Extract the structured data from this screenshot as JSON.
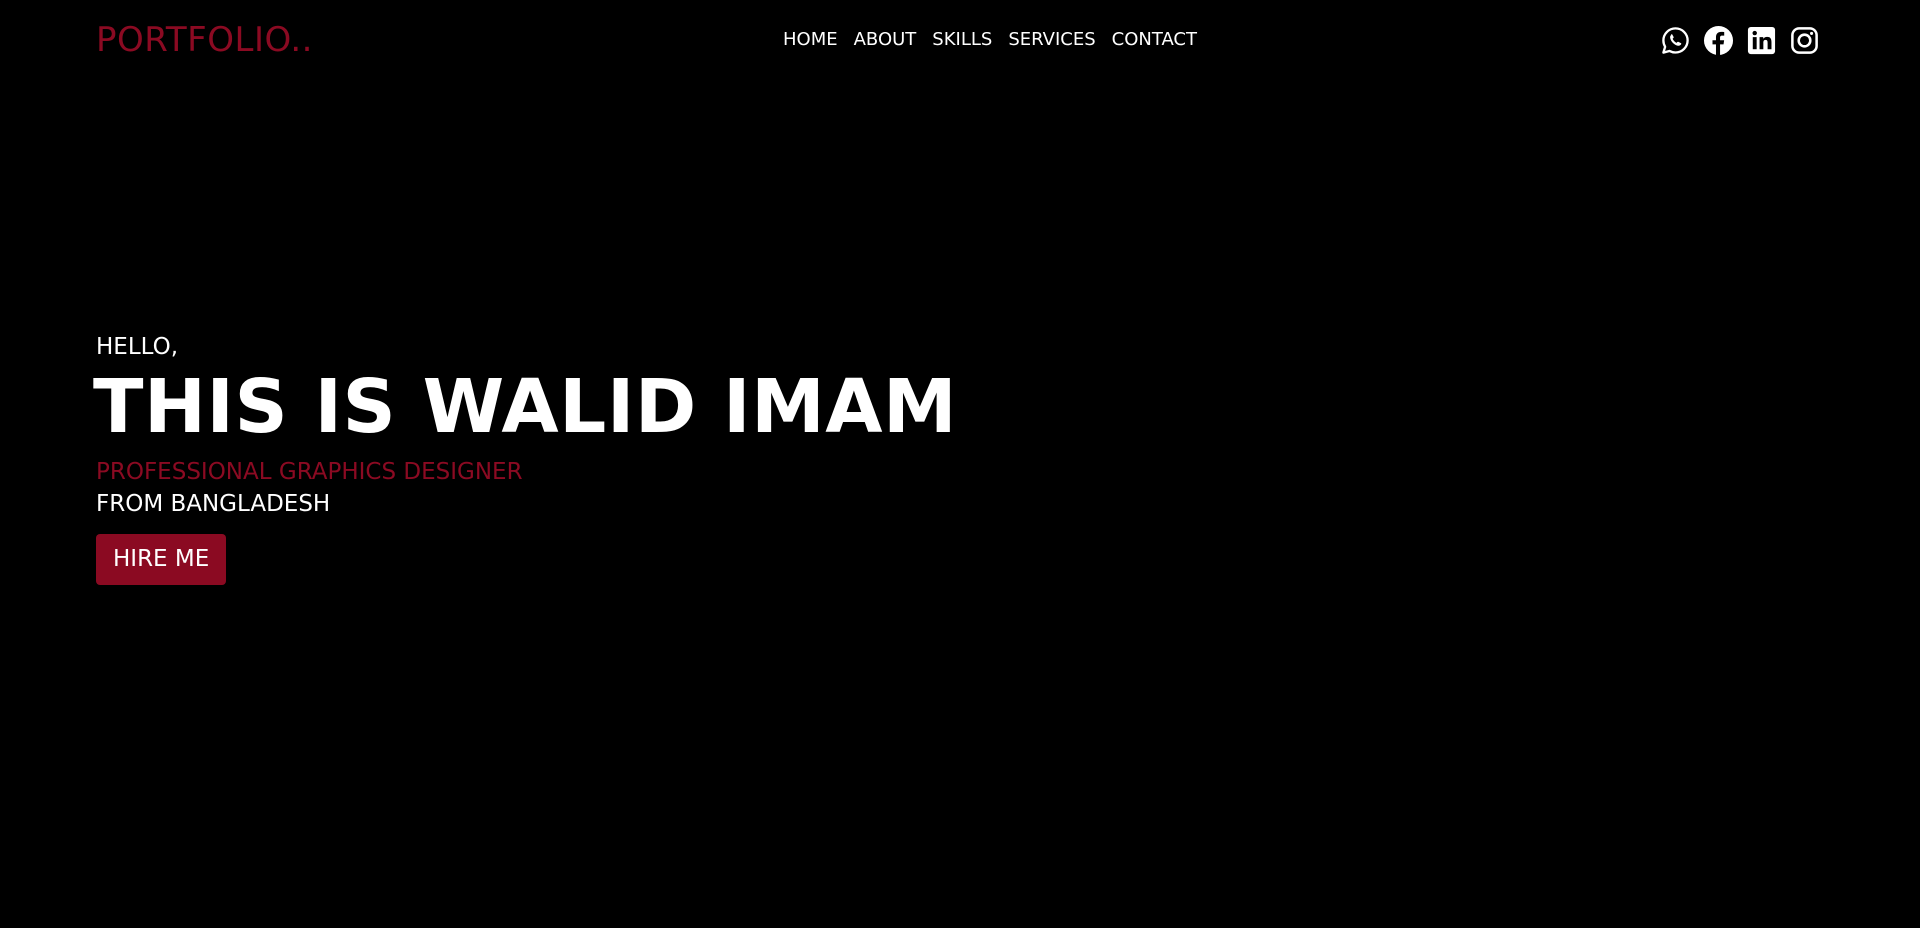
{
  "header": {
    "logo": "PORTFOLIO..",
    "nav": [
      {
        "label": "HOME"
      },
      {
        "label": "ABOUT"
      },
      {
        "label": "SKILLS"
      },
      {
        "label": "SERVICES"
      },
      {
        "label": "CONTACT"
      }
    ],
    "socials": [
      {
        "icon": "whatsapp-icon"
      },
      {
        "icon": "facebook-icon"
      },
      {
        "icon": "linkedin-icon"
      },
      {
        "icon": "instagram-icon"
      }
    ]
  },
  "hero": {
    "greeting": "HELLO,",
    "title": "THIS IS WALID IMAM",
    "profession": "PROFESSIONAL GRAPHICS DESIGNER",
    "origin": "FROM BANGLADESH",
    "cta_label": "HIRE ME"
  },
  "colors": {
    "background": "#000000",
    "accent": "#8b0a22",
    "text": "#ffffff"
  }
}
